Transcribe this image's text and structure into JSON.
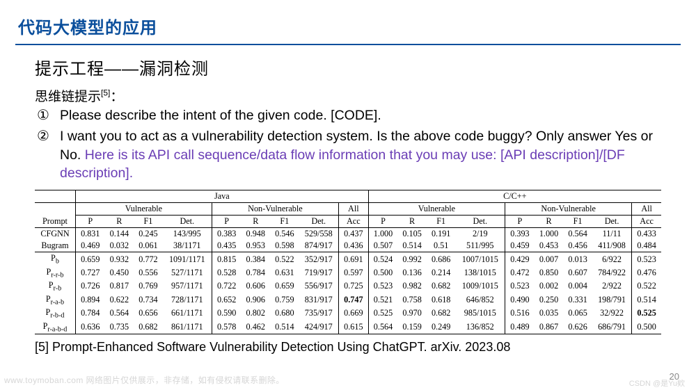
{
  "title": "代码大模型的应用",
  "subtitle": "提示工程——漏洞检测",
  "cot_label": "思维链提示",
  "cot_ref": "[5]",
  "colon": "：",
  "item1_mark": "①",
  "item1_text": "Please describe the intent of the given code. [CODE].",
  "item2_mark": "②",
  "item2_black": "I want you to act as a vulnerability detection system. Is the above code buggy? Only answer Yes or No. ",
  "item2_purple": "Here is its API call sequence/data flow information that you may use: [API description]/[DF description].",
  "footnote": "[5] Prompt-Enhanced Software Vulnerability Detection Using ChatGPT. arXiv. 2023.08",
  "pagenum": "20",
  "wm_left": "www.toymoban.com 网络图片仅供展示，非存储，如有侵权请联系删除。",
  "csdn": "CSDN @是Yu欸",
  "chart_data": {
    "type": "table",
    "top_headers": [
      "Java",
      "C/C++"
    ],
    "sub_headers": [
      "Vulnerable",
      "Non-Vulnerable",
      "All"
    ],
    "metric_header": [
      "Prompt",
      "P",
      "R",
      "F1",
      "Det.",
      "P",
      "R",
      "F1",
      "Det.",
      "Acc",
      "P",
      "R",
      "F1",
      "Det.",
      "P",
      "R",
      "F1",
      "Det.",
      "Acc"
    ],
    "rows": [
      {
        "name": "CFGNN",
        "vals": [
          "0.831",
          "0.144",
          "0.245",
          "143/995",
          "0.383",
          "0.948",
          "0.546",
          "529/558",
          "0.437",
          "1.000",
          "0.105",
          "0.191",
          "2/19",
          "0.393",
          "1.000",
          "0.564",
          "11/11",
          "0.433"
        ]
      },
      {
        "name": "Bugram",
        "vals": [
          "0.469",
          "0.032",
          "0.061",
          "38/1171",
          "0.435",
          "0.953",
          "0.598",
          "874/917",
          "0.436",
          "0.507",
          "0.514",
          "0.51",
          "511/995",
          "0.459",
          "0.453",
          "0.456",
          "411/908",
          "0.484"
        ]
      },
      {
        "name": "Pb",
        "vals": [
          "0.659",
          "0.932",
          "0.772",
          "1091/1171",
          "0.815",
          "0.384",
          "0.522",
          "352/917",
          "0.691",
          "0.524",
          "0.992",
          "0.686",
          "1007/1015",
          "0.429",
          "0.007",
          "0.013",
          "6/922",
          "0.523"
        ]
      },
      {
        "name": "Pr-r-b",
        "vals": [
          "0.727",
          "0.450",
          "0.556",
          "527/1171",
          "0.528",
          "0.784",
          "0.631",
          "719/917",
          "0.597",
          "0.500",
          "0.136",
          "0.214",
          "138/1015",
          "0.472",
          "0.850",
          "0.607",
          "784/922",
          "0.476"
        ]
      },
      {
        "name": "Pr-b",
        "vals": [
          "0.726",
          "0.817",
          "0.769",
          "957/1171",
          "0.722",
          "0.606",
          "0.659",
          "556/917",
          "0.725",
          "0.523",
          "0.982",
          "0.682",
          "1009/1015",
          "0.523",
          "0.002",
          "0.004",
          "2/922",
          "0.522"
        ]
      },
      {
        "name": "Pr-a-b",
        "vals": [
          "0.894",
          "0.622",
          "0.734",
          "728/1171",
          "0.652",
          "0.906",
          "0.759",
          "831/917",
          "0.747",
          "0.521",
          "0.758",
          "0.618",
          "646/852",
          "0.490",
          "0.250",
          "0.331",
          "198/791",
          "0.514"
        ],
        "bold_idx": 8
      },
      {
        "name": "Pr-b-d",
        "vals": [
          "0.784",
          "0.564",
          "0.656",
          "661/1171",
          "0.590",
          "0.802",
          "0.680",
          "735/917",
          "0.669",
          "0.525",
          "0.970",
          "0.682",
          "985/1015",
          "0.516",
          "0.035",
          "0.065",
          "32/922",
          "0.525"
        ],
        "bold_idx": 17
      },
      {
        "name": "Pr-a-b-d",
        "vals": [
          "0.636",
          "0.735",
          "0.682",
          "861/1171",
          "0.578",
          "0.462",
          "0.514",
          "424/917",
          "0.615",
          "0.564",
          "0.159",
          "0.249",
          "136/852",
          "0.489",
          "0.867",
          "0.626",
          "686/791",
          "0.500"
        ]
      }
    ]
  }
}
